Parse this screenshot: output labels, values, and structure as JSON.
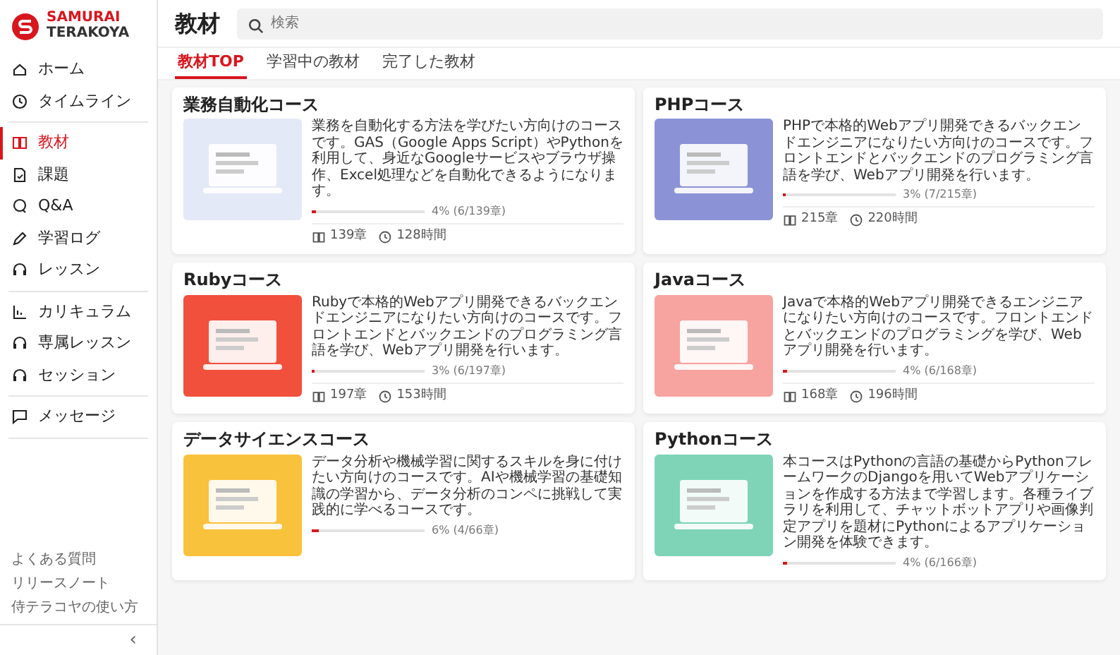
{
  "logo": {
    "line_1": "SAMURAI",
    "line_2": "TERAKOYA"
  },
  "sidebar": {
    "sections": [
      {
        "items": [
          {
            "label": "ホーム",
            "selected": false
          },
          {
            "label": "タイムライン",
            "selected": false
          }
        ]
      },
      {
        "items": [
          {
            "label": "教材",
            "selected": true
          },
          {
            "label": "課題",
            "selected": false
          },
          {
            "label": "Q&A",
            "selected": false
          },
          {
            "label": "学習ログ",
            "selected": false
          },
          {
            "label": "レッスン",
            "selected": false
          }
        ]
      },
      {
        "items": [
          {
            "label": "カリキュラム",
            "selected": false
          },
          {
            "label": "専属レッスン",
            "selected": false
          },
          {
            "label": "セッション",
            "selected": false
          }
        ]
      },
      {
        "items": [
          {
            "label": "メッセージ",
            "selected": false
          }
        ]
      }
    ],
    "links": [
      "よくある質問",
      "リリースノート",
      "侍テラコヤの使い方"
    ],
    "collapse": "‹"
  },
  "header": {
    "title": "教材",
    "search": {
      "placeholder": "検索"
    }
  },
  "tabs": [
    {
      "label": "教材TOP",
      "selected": true
    },
    {
      "label": "学習中の教材",
      "selected": false
    },
    {
      "label": "完了した教材",
      "selected": false
    }
  ],
  "courses": [
    {
      "title": "業務自動化コース",
      "color": "#e4e9f7",
      "description": "業務を自動化する方法を学びたい方向けのコースです。GAS（Google Apps Script）やPythonを利用して、身近なGoogleサービスやブラウザ操作、Excel処理などを自動化できるようになります。",
      "level": 0.04,
      "progress": "4% (6/139章)",
      "chapters": "139章",
      "hours": "128時間"
    },
    {
      "title": "PHPコース",
      "color": "#8b93d6",
      "description": "PHPで本格的Webアプリ開発できるバックエンドエンジニアになりたい方向けのコースです。フロントエンドとバックエンドのプログラミング言語を学び、Webアプリ開発を行います。",
      "level": 0.03,
      "progress": "3% (7/215章)",
      "chapters": "215章",
      "hours": "220時間"
    },
    {
      "title": "Rubyコース",
      "color": "#f0503c",
      "description": "Rubyで本格的Webアプリ開発できるバックエンドエンジニアになりたい方向けのコースです。フロントエンドとバックエンドのプログラミング言語を学び、Webアプリ開発を行います。",
      "level": 0.03,
      "progress": "3% (6/197章)",
      "chapters": "197章",
      "hours": "153時間"
    },
    {
      "title": "Javaコース",
      "color": "#f7a3a0",
      "description": "Javaで本格的Webアプリ開発できるエンジニアになりたい方向けのコースです。フロントエンドとバックエンドのプログラミングを学び、Webアプリ開発を行います。",
      "level": 0.04,
      "progress": "4% (6/168章)",
      "chapters": "168章",
      "hours": "196時間"
    },
    {
      "title": "データサイエンスコース",
      "color": "#f9c23c",
      "description": "データ分析や機械学習に関するスキルを身に付けたい方向けのコースです。AIや機械学習の基礎知識の学習から、データ分析のコンペに挑戦して実践的に学べるコースです。",
      "level": 0.06,
      "progress": "6% (4/66章)"
    },
    {
      "title": "Pythonコース",
      "color": "#7fd4b8",
      "description": "本コースはPythonの言語の基礎からPythonフレームワークのDjangoを用いてWebアプリケーションを作成する方法まで学習します。各種ライブラリを利用して、チャットボットアプリや画像判定アプリを題材にPythonによるアプリケーション開発を体験できます。",
      "level": 0.04,
      "progress": "4% (6/166章)"
    }
  ]
}
